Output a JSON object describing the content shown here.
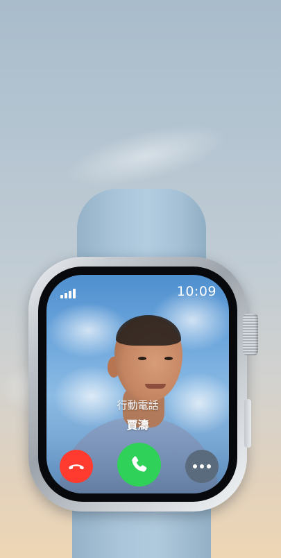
{
  "watch": {
    "time": "10:09",
    "signal_bars": 4
  },
  "call": {
    "caller_type": "行動電話",
    "caller_name": "賈濤"
  },
  "buttons": {
    "decline": {
      "icon": "phone-down-icon",
      "color": "#ff3b30"
    },
    "accept": {
      "icon": "phone-icon",
      "color": "#30d158"
    },
    "more": {
      "icon": "ellipsis-icon",
      "color": "#5b6b7e"
    }
  }
}
